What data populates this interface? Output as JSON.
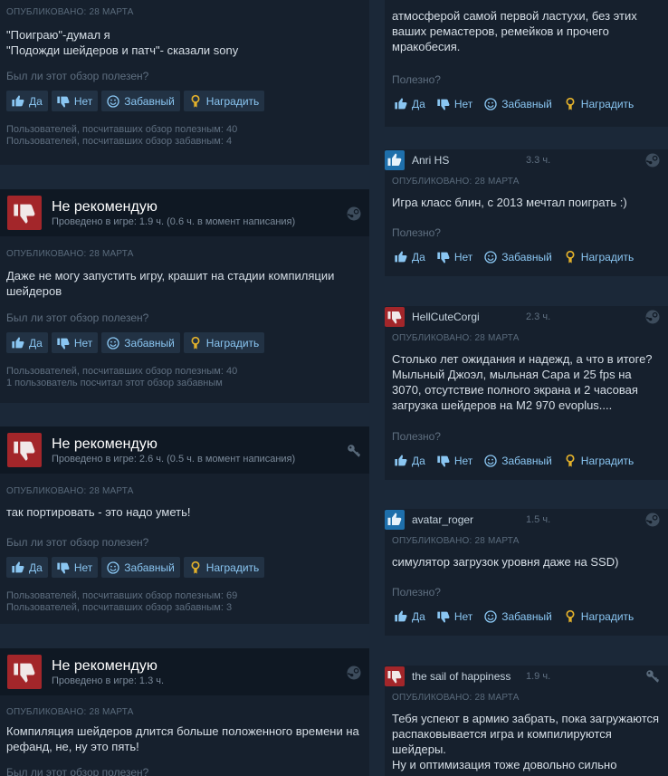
{
  "colors": {
    "background": "#1b2838",
    "card": "#16202d",
    "not_recommended": "#a3262a",
    "recommended": "#1e6fab",
    "link": "#8ac6f2"
  },
  "buttons": {
    "yes": "Да",
    "no": "Нет",
    "funny": "Забавный",
    "award": "Наградить"
  },
  "helpful_question": "Был ли этот обзор полезен?",
  "helpful_short": "Полезно?",
  "left_reviews": [
    {
      "posted": "ОПУБЛИКОВАНО: 28 МАРТА",
      "text": "\"Поиграю\"-думал я\n\"Подожди шейдеров и патч\"- сказали sony",
      "stats": [
        "Пользователей, посчитавших обзор полезным: 40",
        "Пользователей, посчитавших обзор забавным: 4"
      ]
    },
    {
      "verdict": "Не рекомендую",
      "hours": "Проведено в игре: 1.9 ч.",
      "hours_at_review": "(0.6 ч. в момент написания)",
      "posted": "ОПУБЛИКОВАНО: 28 МАРТА",
      "text": "Даже не могу запустить игру, крашит на стадии компиляции шейдеров",
      "stats": [
        "Пользователей, посчитавших обзор полезным: 40",
        "1 пользователь посчитал этот обзор забавным"
      ],
      "badge_icon": "steam-icon"
    },
    {
      "verdict": "Не рекомендую",
      "hours": "Проведено в игре: 2.6 ч.",
      "hours_at_review": "(0.5 ч. в момент написания)",
      "posted": "ОПУБЛИКОВАНО: 28 МАРТА",
      "text": "так портировать - это надо уметь!",
      "stats": [
        "Пользователей, посчитавших обзор полезным: 69",
        "Пользователей, посчитавших обзор забавным: 3"
      ],
      "badge_icon": "key-icon"
    },
    {
      "verdict": "Не рекомендую",
      "hours": "Проведено в игре: 1.3 ч.",
      "posted": "ОПУБЛИКОВАНО: 28 МАРТА",
      "text": "Компиляция шейдеров длится больше положенного времени на рефанд, не, ну это пять!",
      "badge_icon": "steam-icon"
    }
  ],
  "right_reviews": [
    {
      "text": "атмосферой самой первой ластухи, без этих ваших ремастеров, ремейков и прочего мракобесия."
    },
    {
      "author": "Anri HS",
      "hours": "3.3 ч.",
      "type": "up",
      "posted": "ОПУБЛИКОВАНО: 28 МАРТА",
      "text": "Игра класс блин, с 2013 мечтал поиграть :)",
      "badge_icon": "steam-icon"
    },
    {
      "author": "HellCuteCorgi",
      "hours": "2.3 ч.",
      "type": "down",
      "posted": "ОПУБЛИКОВАНО: 28 МАРТА",
      "text": "Столько лет ожидания и надежд, а что в итоге? Мыльный Джоэл, мыльная Сара и 25 fps на 3070, отсутствие полного экрана и 2 часовая загрузка шейдеров на M2 970 evoplus....",
      "badge_icon": "steam-icon"
    },
    {
      "author": "avatar_roger",
      "hours": "1.5 ч.",
      "type": "up",
      "posted": "ОПУБЛИКОВАНО: 28 МАРТА",
      "text": "симулятор загрузок уровня даже на SSD)",
      "badge_icon": "steam-icon"
    },
    {
      "author": "the sail of happiness",
      "hours": "1.9 ч.",
      "type": "down",
      "posted": "ОПУБЛИКОВАНО: 28 МАРТА",
      "text": "Тебя успеют в армию забрать, пока загружаются распаковывается игра и компилируются шейдеры.\nНу и оптимизация тоже довольно сильно",
      "badge_icon": "key-icon"
    }
  ]
}
